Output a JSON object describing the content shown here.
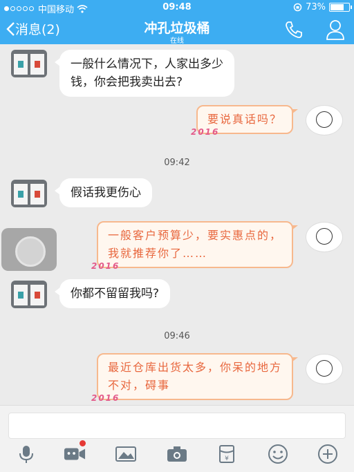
{
  "status": {
    "carrier": "中国移动",
    "time": "09:48",
    "battery": "73%",
    "battery_level": 0.73
  },
  "nav": {
    "back_label": "消息(2)",
    "title": "冲孔垃圾桶",
    "subtitle": "在线"
  },
  "messages": [
    {
      "text_line1": "一般什么情况下，人家出多少",
      "text_line2": "钱，你会把我卖出去?"
    },
    {
      "text": "要说真话吗？"
    },
    {
      "text": "假话我更伤心"
    },
    {
      "text_line1": "一般客户预算少，要实惠点的，",
      "text_line2": "我就推荐你了……"
    },
    {
      "text": "你都不留留我吗?"
    },
    {
      "text_line1": "最近仓库出货太多，你呆的地方",
      "text_line2": "不对，碍事"
    }
  ],
  "timestamps": [
    "09:42",
    "09:46"
  ],
  "deco_label": "2016",
  "toolbar": [
    "mic-icon",
    "video-icon",
    "image-icon",
    "camera-icon",
    "red-packet-icon",
    "emoji-icon",
    "plus-icon"
  ],
  "colors": {
    "header": "#3dadf2",
    "bubble_right_border": "#f7b88d",
    "bubble_right_text": "#e8673e"
  }
}
